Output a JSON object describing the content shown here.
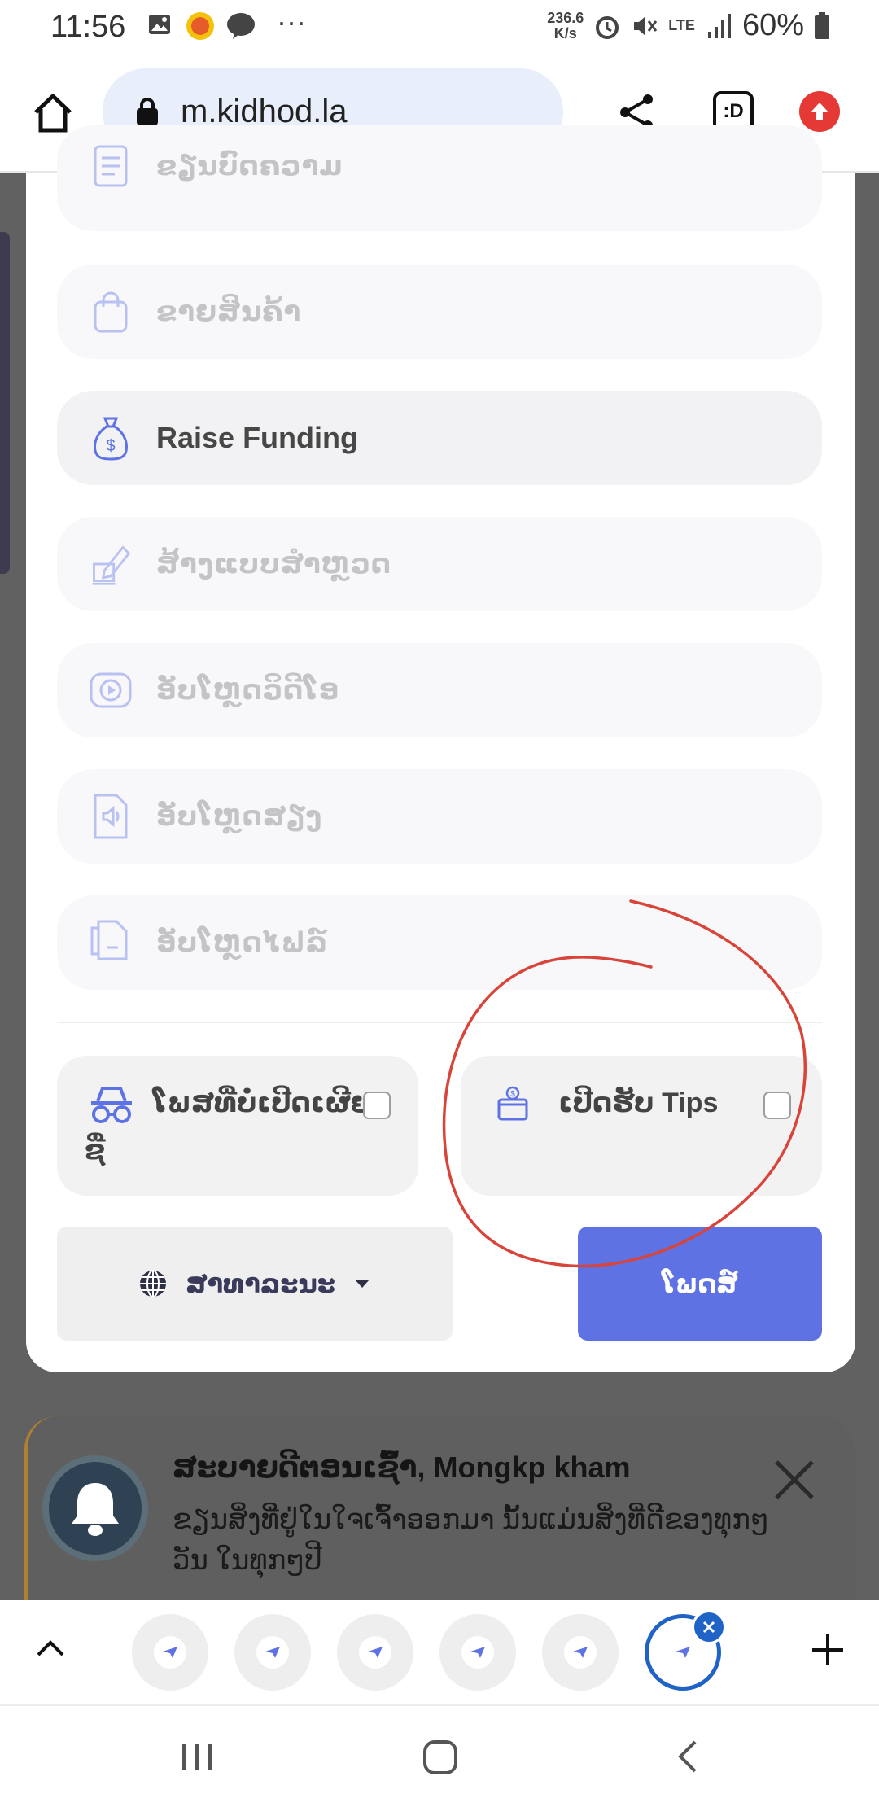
{
  "status_bar": {
    "time": "11:56",
    "net_speed_value": "236.6",
    "net_speed_unit": "K/s",
    "network": "LTE",
    "battery": "60%",
    "more": "···"
  },
  "browser": {
    "url": "m.kidhod.la",
    "tab_button_label": ":D"
  },
  "menu_options": [
    {
      "label": "ຂຽນບົດຄວາມ",
      "icon": "document-icon",
      "active": false
    },
    {
      "label": "ຂາຍສິນຄ້າ",
      "icon": "shopping-bag-icon",
      "active": false
    },
    {
      "label": "Raise Funding",
      "icon": "money-bag-icon",
      "active": true
    },
    {
      "label": "ສ້າງແບບສຳຫຼວດ",
      "icon": "edit-survey-icon",
      "active": false
    },
    {
      "label": "ອັບໂຫຼດວິດີໂອ",
      "icon": "video-icon",
      "active": false
    },
    {
      "label": "ອັບໂຫຼດສຽງ",
      "icon": "audio-file-icon",
      "active": false
    },
    {
      "label": "ອັບໂຫຼດໄຟລ໌",
      "icon": "file-icon",
      "active": false
    }
  ],
  "anonymous_post": {
    "label_line1": "ໂພສທີ່ບໍ່ເປີດເຜີຍ",
    "label_line2": "ຊື່",
    "checked": false
  },
  "tips": {
    "label": "ເປີດຮັບ Tips",
    "checked": false
  },
  "privacy": {
    "selected": "ສາທາລະນະ"
  },
  "post_button": "ໂພດສ໌",
  "notification": {
    "title": "ສະບາຍດີຕອນເຊົ້າ, Mongkp kham",
    "body": "ຂຽນສິ່ງທີ່ຢູ່ໃນໃຈເຈົ້າອອກມາ ນັ້ນແມ່ນສິ່ງທີ່ດີຂອງທຸກໆວັນ ໃນທຸກໆປີ"
  },
  "tab_strip": {
    "tab_count_visible": 6,
    "current_tab_index": 5
  },
  "colors": {
    "accent": "#5e72e4",
    "annotation": "#d9443a",
    "tab_highlight": "#1f63c6"
  }
}
